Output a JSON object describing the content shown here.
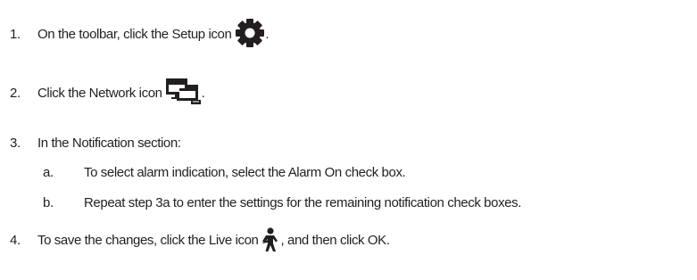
{
  "steps": [
    {
      "number": "1.",
      "text_before": "On the toolbar, click the Setup icon",
      "icon": "gear-icon",
      "text_after": "."
    },
    {
      "number": "2.",
      "text_before": "Click the Network icon",
      "icon": "network-icon",
      "text_after": "."
    },
    {
      "number": "3.",
      "text": "In the Notification section:",
      "substeps": [
        {
          "letter": "a.",
          "text": "To select alarm indication, select the Alarm On check box."
        },
        {
          "letter": "b.",
          "text": "Repeat step 3a to enter the settings for the remaining notification check boxes."
        }
      ]
    },
    {
      "number": "4.",
      "text_before": "To save the changes, click the Live icon",
      "icon": "live-person-icon",
      "text_after": ", and then click OK."
    }
  ],
  "colors": {
    "text": "#231f20",
    "icon": "#231f20"
  }
}
